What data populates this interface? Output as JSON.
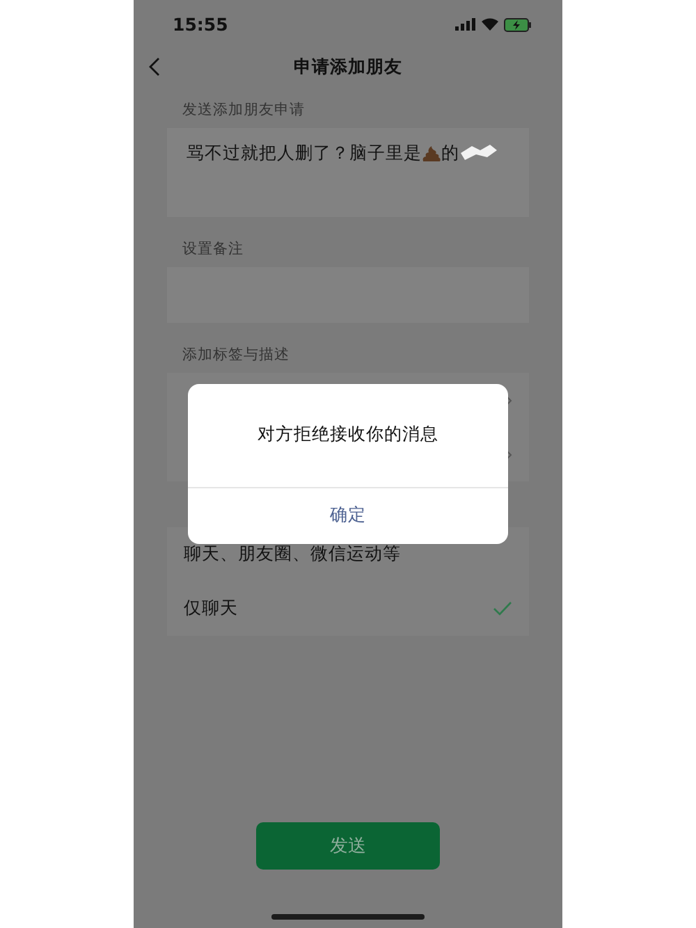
{
  "status_bar": {
    "time": "15:55"
  },
  "nav": {
    "title": "申请添加朋友"
  },
  "request": {
    "label": "发送添加朋友申请",
    "message_start": "骂不过就把人删了？脑子里是",
    "message_after_icon": "的"
  },
  "remark": {
    "label": "设置备注"
  },
  "tags": {
    "label": "添加标签与描述"
  },
  "permissions": {
    "options": [
      {
        "label": "聊天、朋友圈、微信运动等",
        "selected": false
      },
      {
        "label": "仅聊天",
        "selected": true
      }
    ]
  },
  "send_button": {
    "label": "发送"
  },
  "dialog": {
    "message": "对方拒绝接收你的消息",
    "buttons": [
      {
        "label": "确定"
      }
    ]
  }
}
